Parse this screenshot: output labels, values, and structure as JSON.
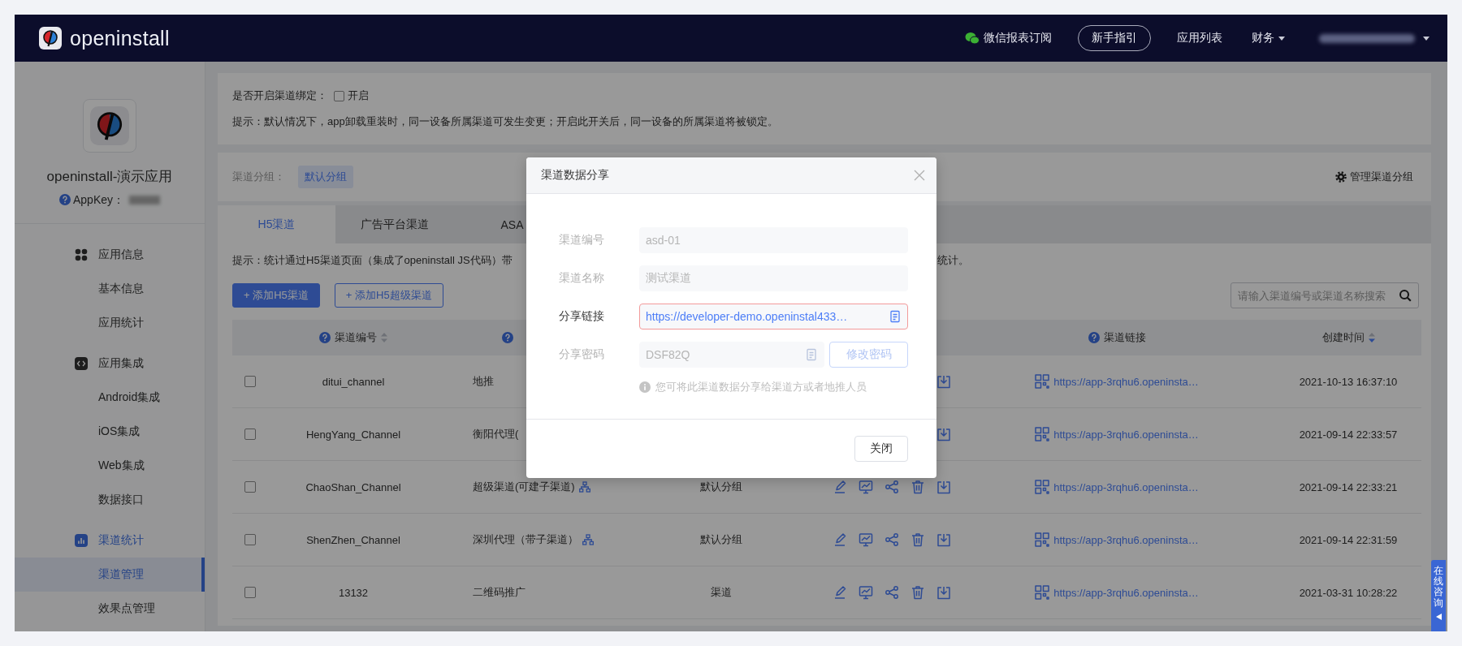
{
  "header": {
    "logo": "openinstall",
    "nav": [
      {
        "kind": "wechat",
        "label": "微信报表订阅"
      },
      {
        "kind": "pill",
        "label": "新手指引"
      },
      {
        "kind": "link",
        "label": "应用列表"
      },
      {
        "kind": "dropdown",
        "label": "财务"
      }
    ]
  },
  "sidebar": {
    "app_name": "openinstall-演示应用",
    "appkey_label": "AppKey：",
    "groups": [
      {
        "title": "应用信息",
        "active": false,
        "items": [
          {
            "label": "基本信息",
            "selected": false
          },
          {
            "label": "应用统计",
            "selected": false
          }
        ]
      },
      {
        "title": "应用集成",
        "active": false,
        "items": [
          {
            "label": "Android集成",
            "selected": false
          },
          {
            "label": "iOS集成",
            "selected": false
          },
          {
            "label": "Web集成",
            "selected": false
          },
          {
            "label": "数据接口",
            "selected": false
          }
        ]
      },
      {
        "title": "渠道统计",
        "active": true,
        "items": [
          {
            "label": "渠道管理",
            "selected": true
          },
          {
            "label": "效果点管理",
            "selected": false
          }
        ]
      }
    ]
  },
  "binding": {
    "label": "是否开启渠道绑定：",
    "checkbox_label": "开启",
    "checked": false,
    "hint": "提示：默认情况下，app卸载重装时，同一设备所属渠道可发生变更；开启此开关后，同一设备的所属渠道将被锁定。"
  },
  "channel_groups": {
    "label": "渠道分组：",
    "tags": [
      {
        "label": "默认分组",
        "selected": true
      }
    ],
    "manage": "管理渠道分组"
  },
  "tabs": [
    {
      "label": "H5渠道",
      "selected": true
    },
    {
      "label": "广告平台渠道",
      "selected": false
    },
    {
      "label": "ASA",
      "selected": false
    }
  ],
  "h5_hint": {
    "left": "提示：统计通过H5渠道页面（集成了openinstall JS代码）带",
    "right": "统计。"
  },
  "toolbar": {
    "buttons": [
      {
        "kind": "primary",
        "label": "+ 添加H5渠道"
      },
      {
        "kind": "outline",
        "label": "+ 添加H5超级渠道"
      }
    ],
    "search": {
      "placeholder": "请输入渠道编号或渠道名称搜索"
    }
  },
  "table": {
    "columns": [
      {
        "kind": "heading",
        "label": "渠道编号",
        "help": true,
        "sortable": true,
        "sorted_desc": false
      },
      {
        "kind": "heading",
        "help": true
      },
      {
        "kind": "covered"
      },
      {
        "kind": "covered"
      },
      {
        "kind": "heading",
        "label": "渠道链接",
        "help": true
      },
      {
        "kind": "heading",
        "label": "创建时间",
        "help": false,
        "sortable": true,
        "sorted_desc": true
      }
    ],
    "rows": [
      {
        "checked": false,
        "channel_id": "ditui_channel",
        "name": "地推",
        "sub_channels": false,
        "link": "https://app-3rqhu6.openinsta…",
        "created": "2021-10-13 16:37:10"
      },
      {
        "checked": false,
        "channel_id": "HengYang_Channel",
        "name": "衡阳代理(",
        "sub_channels": false,
        "link": "https://app-3rqhu6.openinsta…",
        "created": "2021-09-14 22:33:57"
      },
      {
        "checked": false,
        "channel_id": "ChaoShan_Channel",
        "name": "超级渠道(可建子渠道)",
        "sub_channels": true,
        "group": "默认分组",
        "link": "https://app-3rqhu6.openinsta…",
        "created": "2021-09-14 22:33:21"
      },
      {
        "checked": false,
        "channel_id": "ShenZhen_Channel",
        "name": "深圳代理（带子渠道）",
        "sub_channels": true,
        "group": "默认分组",
        "link": "https://app-3rqhu6.openinsta…",
        "created": "2021-09-14 22:31:59"
      },
      {
        "checked": false,
        "channel_id": "13132",
        "name": "二维码推广",
        "sub_channels": false,
        "group": "渠道",
        "link": "https://app-3rqhu6.openinsta…",
        "created": "2021-03-31 10:28:22"
      }
    ]
  },
  "modal": {
    "title": "渠道数据分享",
    "fields": [
      {
        "kind": "readonly",
        "label": "渠道编号",
        "value": "asd-01",
        "copy": false
      },
      {
        "kind": "readonly",
        "label": "渠道名称",
        "value": "测试渠道",
        "copy": false
      },
      {
        "kind": "link",
        "label": "分享链接",
        "value": "https://developer-demo.openinstal433…",
        "copy": true
      },
      {
        "kind": "password",
        "label": "分享密码",
        "value": "DSF82Q",
        "copy": true,
        "button": "修改密码"
      }
    ],
    "hint": "您可将此渠道数据分享给渠道方或者地推人员",
    "buttons": [
      "关闭"
    ]
  },
  "chat_tab": {
    "label": "在线咨询"
  }
}
